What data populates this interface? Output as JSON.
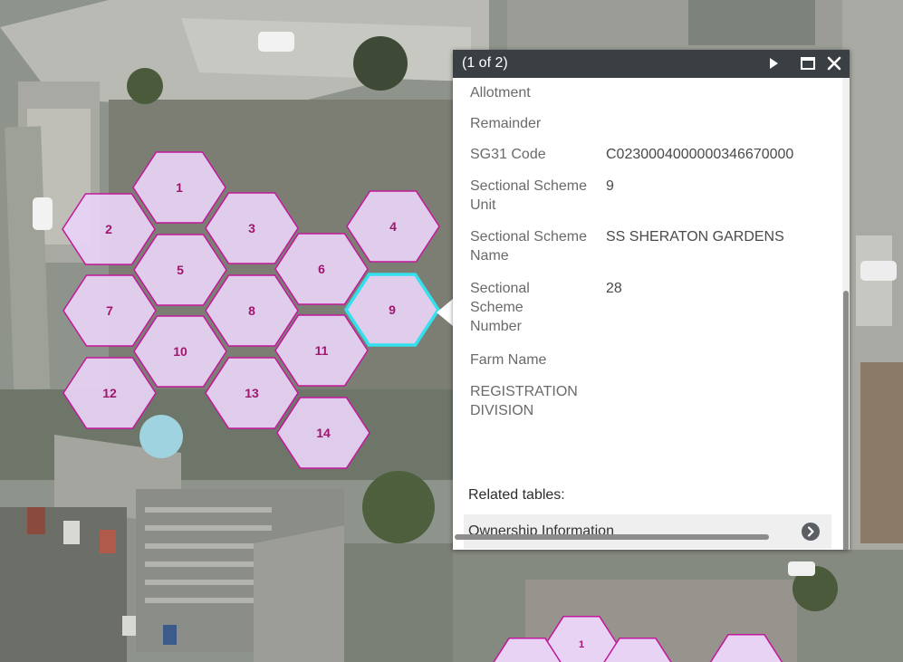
{
  "colors": {
    "parcel_fill": "#e8d3f5",
    "parcel_stroke": "#c2189a",
    "selected_stroke": "#33e0ee",
    "header_bg": "#3a3f44"
  },
  "map": {
    "parcels": [
      {
        "id": "1",
        "label": "1"
      },
      {
        "id": "2",
        "label": "2"
      },
      {
        "id": "3",
        "label": "3"
      },
      {
        "id": "4",
        "label": "4"
      },
      {
        "id": "5",
        "label": "5"
      },
      {
        "id": "6",
        "label": "6"
      },
      {
        "id": "7",
        "label": "7"
      },
      {
        "id": "8",
        "label": "8"
      },
      {
        "id": "9",
        "label": "9",
        "selected": true
      },
      {
        "id": "10",
        "label": "10"
      },
      {
        "id": "11",
        "label": "11"
      },
      {
        "id": "12",
        "label": "12"
      },
      {
        "id": "13",
        "label": "13"
      },
      {
        "id": "14",
        "label": "14"
      }
    ],
    "inset_parcel_label": "1"
  },
  "popup": {
    "title": "(1 of 2)",
    "next_icon": "next-feature-icon",
    "maximize_icon": "maximize-icon",
    "close_icon": "close-icon",
    "attributes": [
      {
        "label": "Allotment",
        "value": ""
      },
      {
        "label": "Remainder",
        "value": ""
      },
      {
        "label": "SG31 Code",
        "value": "C0230004000000346670000"
      },
      {
        "label": "Sectional Scheme Unit",
        "value": "9"
      },
      {
        "label": "Sectional Scheme Name",
        "value": "SS SHERATON GARDENS"
      },
      {
        "label": "Sectional Scheme Number",
        "value": "28"
      },
      {
        "label": "Farm Name",
        "value": ""
      },
      {
        "label": "REGISTRATION DIVISION",
        "value": ""
      }
    ],
    "related_heading": "Related tables:",
    "related_items": [
      {
        "label": "Ownership Information",
        "icon": "chevron-right-circle-icon"
      }
    ]
  }
}
